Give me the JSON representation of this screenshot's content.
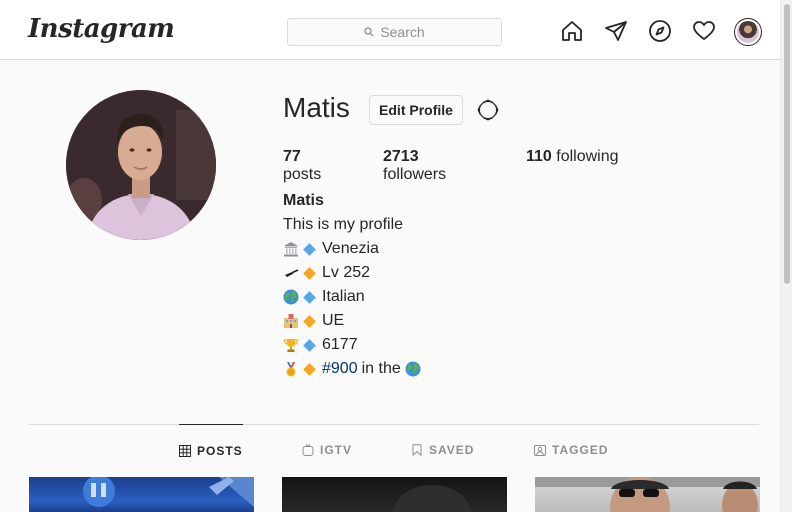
{
  "app": {
    "logo_text": "Instagram"
  },
  "search": {
    "placeholder": "Search"
  },
  "nav": {
    "icons": [
      "home-icon",
      "direct-icon",
      "explore-icon",
      "activity-heart-icon",
      "profile-avatar"
    ]
  },
  "profile": {
    "username": "Matis",
    "edit_label": "Edit Profile",
    "stats": {
      "posts_count": "77",
      "posts_label": "posts",
      "followers_count": "2713",
      "followers_label": "followers",
      "following_count": "110",
      "following_label": "following"
    },
    "bio": {
      "full_name": "Matis",
      "tagline": "This is my profile",
      "lines": [
        {
          "emoji": "classical-building",
          "diamond": "blue",
          "text": "Venezia"
        },
        {
          "emoji": "black-nib",
          "diamond": "orange",
          "text": "Lv 252"
        },
        {
          "emoji": "globe",
          "diamond": "blue",
          "text": "Italian"
        },
        {
          "emoji": "school-building",
          "diamond": "orange",
          "text": "UE"
        },
        {
          "emoji": "trophy",
          "diamond": "blue",
          "text": "6177"
        }
      ],
      "rank_line": {
        "emoji": "first-place-medal",
        "diamond": "orange",
        "hashtag": "#900",
        "text": "in the"
      }
    }
  },
  "tabs": [
    {
      "label": "POSTS",
      "icon": "grid-icon",
      "active": true
    },
    {
      "label": "IGTV",
      "icon": "igtv-icon",
      "active": false
    },
    {
      "label": "SAVED",
      "icon": "bookmark-icon",
      "active": false
    },
    {
      "label": "TAGGED",
      "icon": "tagged-icon",
      "active": false
    }
  ],
  "colors": {
    "diamond_blue": "#5ba7e6",
    "diamond_orange": "#f5a623",
    "hashtag_link": "#00376b",
    "border": "#dbdbdb",
    "text": "#262626",
    "muted": "#8e8e8e"
  }
}
